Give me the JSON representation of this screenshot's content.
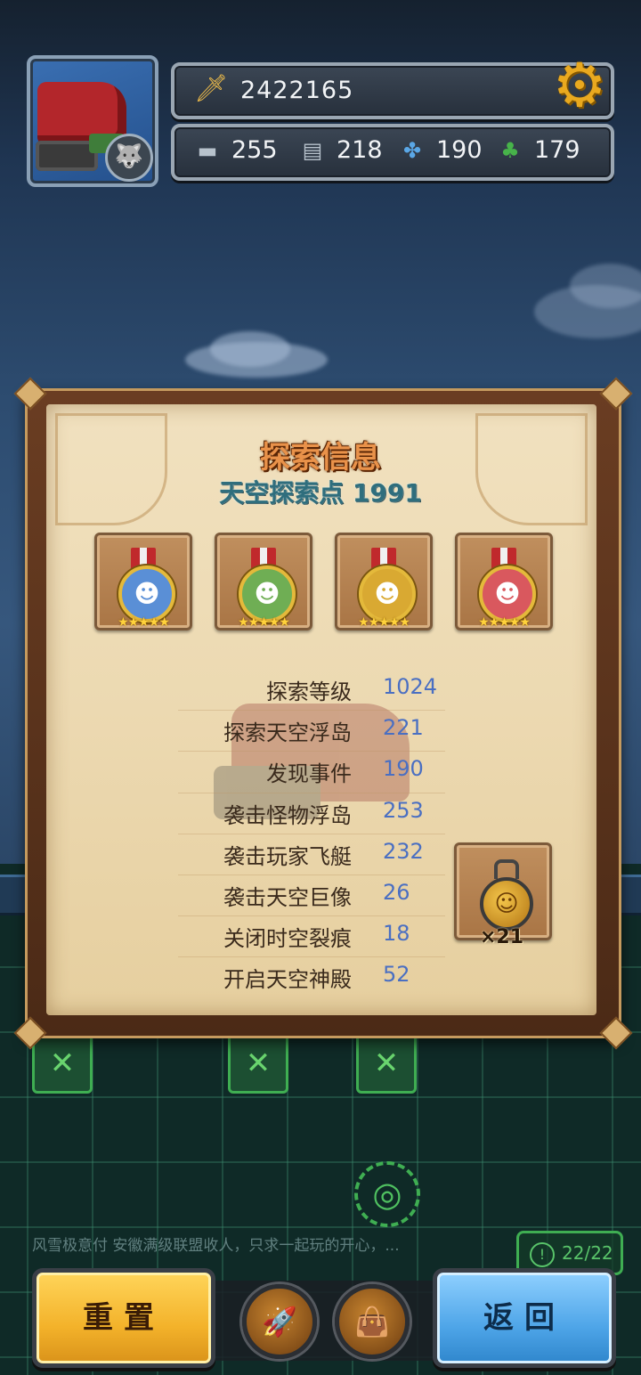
{
  "hud": {
    "power": "2422165",
    "resources": [
      {
        "icon": "tank-res-icon",
        "value": "255"
      },
      {
        "icon": "paper-res-icon",
        "value": "218"
      },
      {
        "icon": "fan-res-icon",
        "value": "190"
      },
      {
        "icon": "clover-res-icon",
        "value": "179"
      }
    ]
  },
  "panel": {
    "title": "探索信息",
    "subtitle": "天空探索点 1991",
    "medals": [
      {
        "icon": "blue-monkey-medal-icon",
        "color": "#5a8fd6",
        "stars": 5
      },
      {
        "icon": "green-beast-medal-icon",
        "color": "#6fae54",
        "stars": 5
      },
      {
        "icon": "gold-warrior-medal-icon",
        "color": "#d9a932",
        "stars": 5
      },
      {
        "icon": "red-boar-medal-icon",
        "color": "#d9585e",
        "stars": 5
      }
    ],
    "stats": [
      {
        "label": "探索等级",
        "value": "1024"
      },
      {
        "label": "探索天空浮岛",
        "value": "221"
      },
      {
        "label": "发现事件",
        "value": "190"
      },
      {
        "label": "袭击怪物浮岛",
        "value": "253"
      },
      {
        "label": "袭击玩家飞艇",
        "value": "232"
      },
      {
        "label": "袭击天空巨像",
        "value": "26"
      },
      {
        "label": "关闭时空裂痕",
        "value": "18"
      },
      {
        "label": "开启天空神殿",
        "value": "52"
      }
    ],
    "reward": {
      "icon": "gold-medal-reward-icon",
      "count": "×21"
    }
  },
  "chat": "风雪极意付  安徽满级联盟收人，只求一起玩的开心，...",
  "counter": "22/22",
  "buttons": {
    "reset": "重置",
    "back": "返回"
  },
  "colors": {
    "accent_gold": "#f3b22a",
    "accent_blue": "#4ea5e8",
    "stat_value": "#4a6fc2",
    "board_green": "#3fae52"
  }
}
